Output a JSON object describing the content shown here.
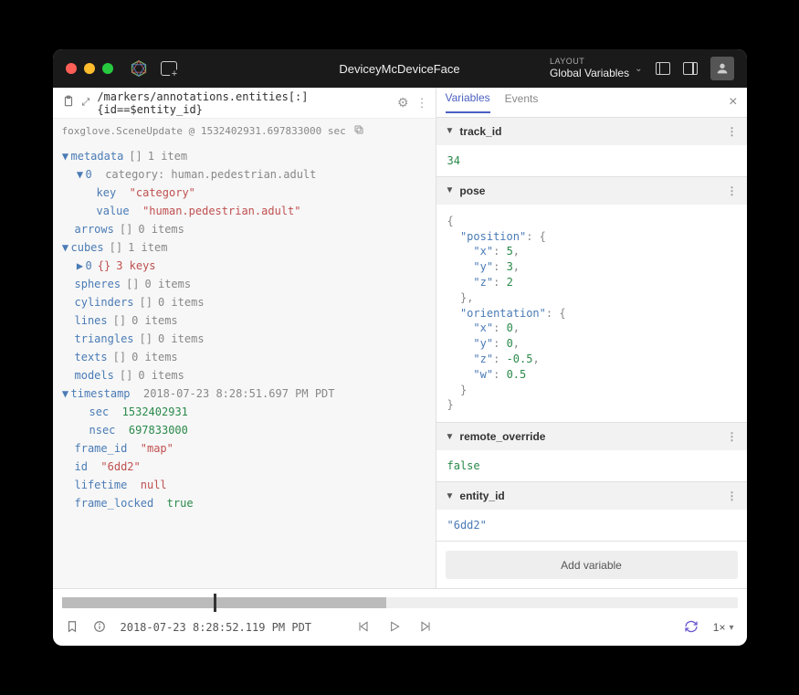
{
  "titlebar": {
    "app_title": "DeviceyMcDeviceFace",
    "layout_label": "LAYOUT",
    "layout_value": "Global Variables"
  },
  "left": {
    "path": "/markers/annotations.entities[:]{id==$entity_id}",
    "schema": "foxglove.SceneUpdate @ 1532402931.697833000 sec",
    "tree": {
      "metadata": {
        "count": "1 item"
      },
      "metadata_0": "category: human.pedestrian.adult",
      "metadata_key": "\"category\"",
      "metadata_value": "\"human.pedestrian.adult\"",
      "arrows": "0 items",
      "cubes": "1 item",
      "cubes_0_keys": "3 keys",
      "spheres": "0 items",
      "cylinders": "0 items",
      "lines": "0 items",
      "triangles": "0 items",
      "texts": "0 items",
      "models": "0 items",
      "timestamp": "2018-07-23 8:28:51.697 PM PDT",
      "sec": "1532402931",
      "nsec": "697833000",
      "frame_id": "\"map\"",
      "id": "\"6dd2\"",
      "lifetime": "null",
      "frame_locked": "true"
    }
  },
  "right": {
    "tabs": {
      "variables": "Variables",
      "events": "Events"
    },
    "vars": {
      "track_id": {
        "name": "track_id",
        "value": "34"
      },
      "pose": {
        "name": "pose",
        "position_k": "\"position\"",
        "x_k": "\"x\"",
        "x_v": "5",
        "y_k": "\"y\"",
        "y_v": "3",
        "z_k": "\"z\"",
        "z_v": "2",
        "orientation_k": "\"orientation\"",
        "ox_k": "\"x\"",
        "ox_v": "0",
        "oy_k": "\"y\"",
        "oy_v": "0",
        "oz_k": "\"z\"",
        "oz_v": "-0.5",
        "ow_k": "\"w\"",
        "ow_v": "0.5"
      },
      "remote_override": {
        "name": "remote_override",
        "value": "false"
      },
      "entity_id": {
        "name": "entity_id",
        "value": "\"6dd2\""
      }
    },
    "add_variable": "Add variable"
  },
  "bottom": {
    "timestamp": "2018-07-23 8:28:52.119 PM PDT",
    "speed": "1×"
  }
}
